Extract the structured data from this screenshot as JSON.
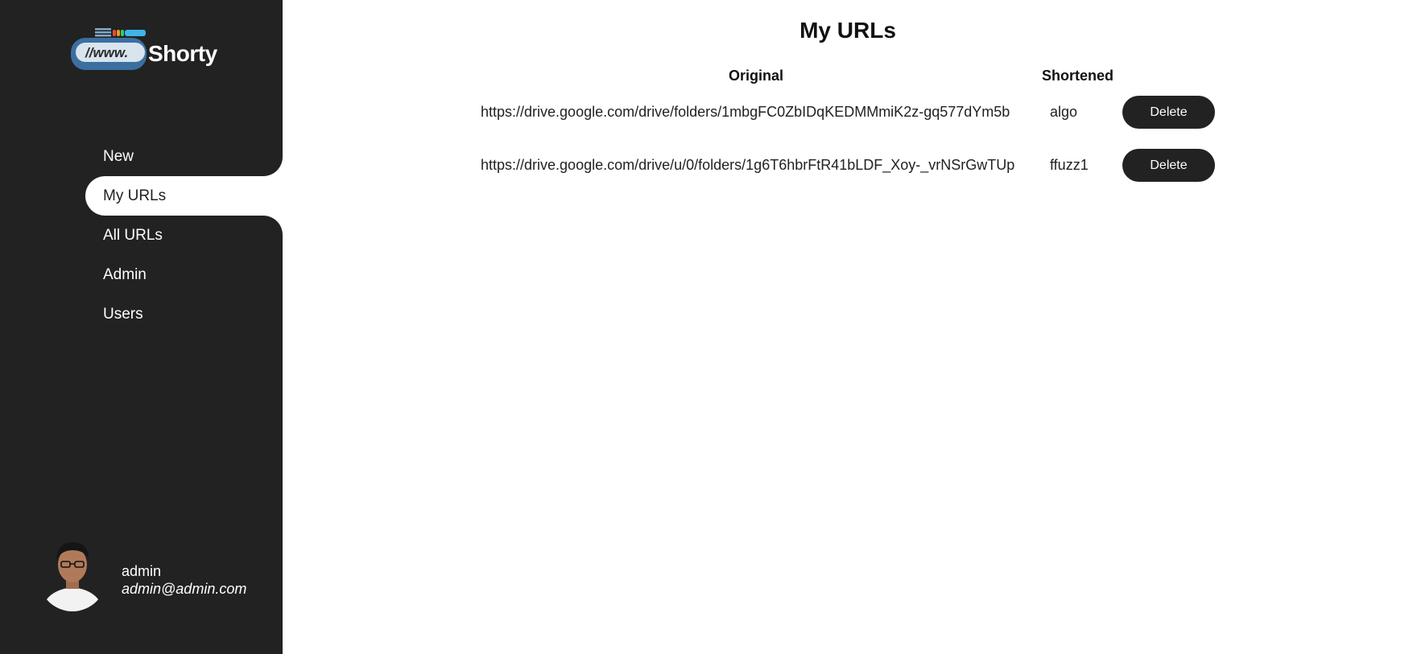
{
  "app": {
    "logo_www": "//www.",
    "logo_name": "Shorty"
  },
  "sidebar": {
    "items": [
      {
        "label": "New"
      },
      {
        "label": "My URLs"
      },
      {
        "label": "All URLs"
      },
      {
        "label": "Admin"
      },
      {
        "label": "Users"
      }
    ],
    "active": "My URLs"
  },
  "user": {
    "name": "admin",
    "email": "admin@admin.com"
  },
  "main": {
    "title": "My URLs",
    "columns": {
      "original": "Original",
      "shortened": "Shortened"
    },
    "rows": [
      {
        "original": "https://drive.google.com/drive/folders/1mbgFC0ZbIDqKEDMMmiK2z-gq577dYm5b",
        "shortened": "algo",
        "action": "Delete"
      },
      {
        "original": "https://drive.google.com/drive/u/0/folders/1g6T6hbrFtR41bLDF_Xoy-_vrNSrGwTUp",
        "shortened": "ffuzz1",
        "action": "Delete"
      }
    ]
  },
  "colors": {
    "sidebar_bg": "#222222",
    "button_bg": "#222222",
    "active_item_bg": "#ffffff"
  }
}
